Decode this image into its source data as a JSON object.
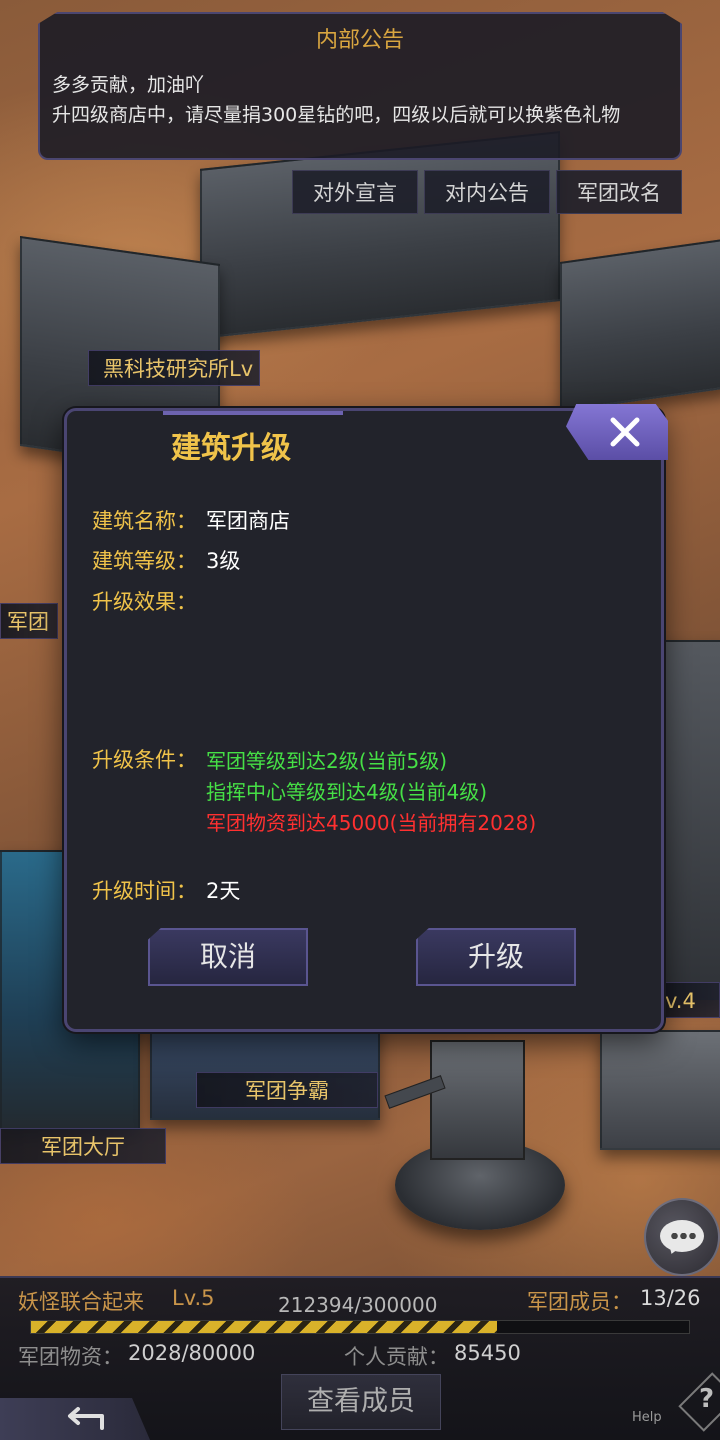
{
  "notice": {
    "title": "内部公告",
    "lines": [
      "多多贡献，加油吖",
      "升四级商店中，请尽量捐300星钻的吧，四级以后就可以换紫色礼物"
    ]
  },
  "notice_buttons": [
    "对外宣言",
    "对内公告",
    "军团改名"
  ],
  "map_labels": {
    "lab": "黑科技研究所Lv",
    "left_cut_1": "军团",
    "right_cut": "v.4",
    "contest": "军团争霸",
    "hall": "军团大厅"
  },
  "modal": {
    "title": "建筑升级",
    "name_label": "建筑名称：",
    "name_value": "军团商店",
    "level_label": "建筑等级：",
    "level_value": "3级",
    "effect_label": "升级效果：",
    "effect_value": "",
    "cond_label": "升级条件：",
    "conditions": [
      {
        "text": "军团等级到达2级(当前5级)",
        "met": true
      },
      {
        "text": "指挥中心等级到达4级(当前4级)",
        "met": true
      },
      {
        "text": "军团物资到达45000(当前拥有2028)",
        "met": false
      }
    ],
    "time_label": "升级时间：",
    "time_value": "2天",
    "cancel_label": "取消",
    "upgrade_label": "升级"
  },
  "guild": {
    "name": "妖怪联合起来",
    "level": "Lv.5",
    "exp_text": "212394/300000",
    "exp_fraction": 0.708,
    "members_label": "军团成员：",
    "members_value": "13/26",
    "supplies_label": "军团物资：",
    "supplies_value": "2028/80000",
    "contribution_label": "个人贡献：",
    "contribution_value": "85450",
    "view_members_label": "查看成员",
    "help_label": "Help"
  },
  "colors": {
    "accent_gold": "#f0c34a",
    "condition_met": "#46e046",
    "condition_unmet": "#ff3030",
    "frame_purple": "#4a4572"
  }
}
